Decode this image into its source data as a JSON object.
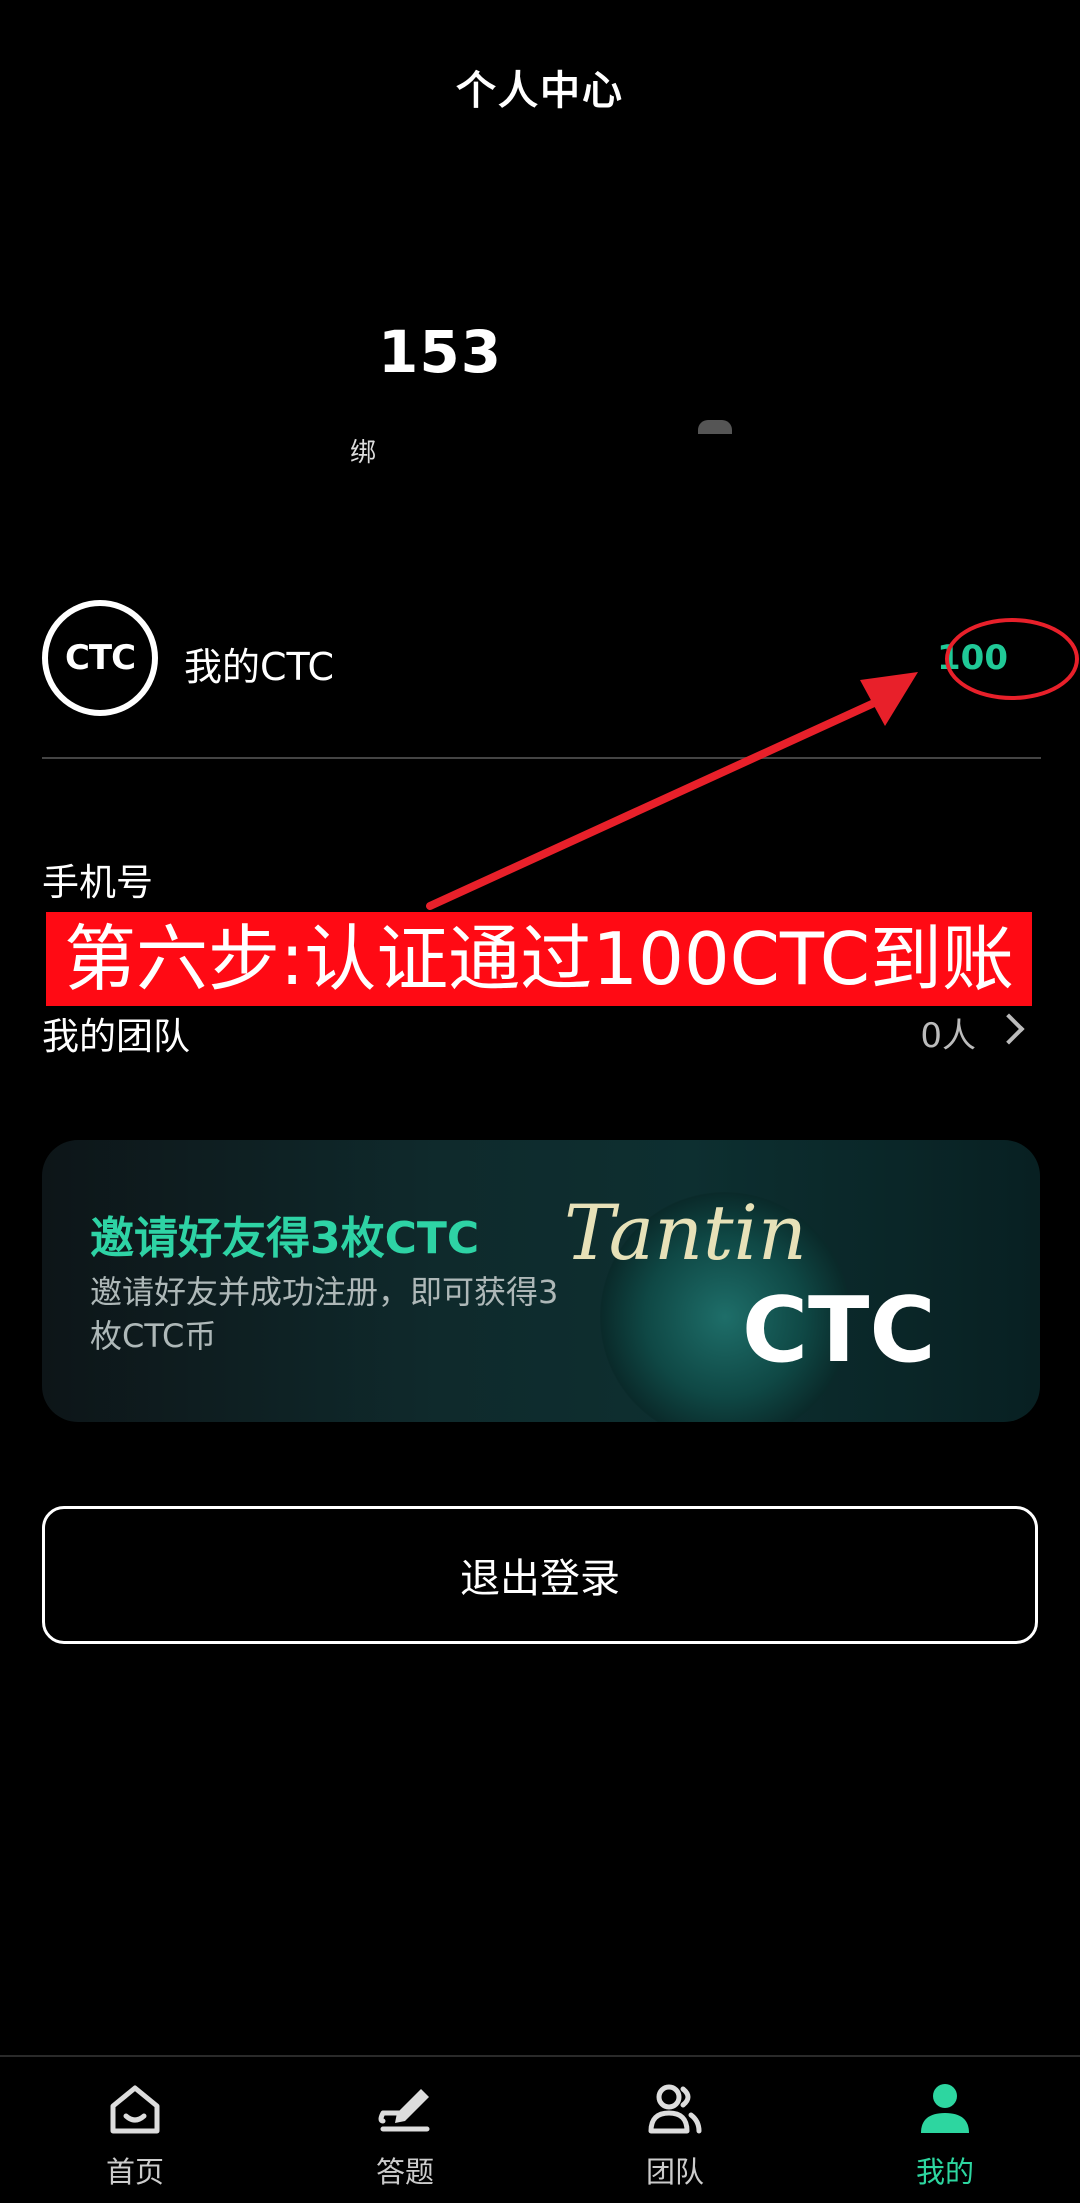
{
  "header": {
    "title": "个人中心"
  },
  "user": {
    "name": "153",
    "subtitle": "绑"
  },
  "ctc": {
    "logo_text": "CTC",
    "label": "我的CTC",
    "value": "100"
  },
  "phone": {
    "label": "手机号"
  },
  "annotation": {
    "text": "第六步:认证通过100CTC到账"
  },
  "team": {
    "label": "我的团队",
    "count": "0人"
  },
  "banner": {
    "title": "邀请好友得3枚CTC",
    "desc": "邀请好友并成功注册，即可获得3枚CTC币",
    "brand_line1": "Tantin",
    "brand_line2": "CTC"
  },
  "logout": {
    "label": "退出登录"
  },
  "nav": {
    "items": [
      {
        "label": "首页",
        "icon": "home-icon"
      },
      {
        "label": "答题",
        "icon": "pen-icon"
      },
      {
        "label": "团队",
        "icon": "team-icon"
      },
      {
        "label": "我的",
        "icon": "user-icon"
      }
    ],
    "active_color": "#2dd6a0"
  },
  "colors": {
    "accent": "#20c997",
    "annotation_red": "#ff0a14"
  }
}
